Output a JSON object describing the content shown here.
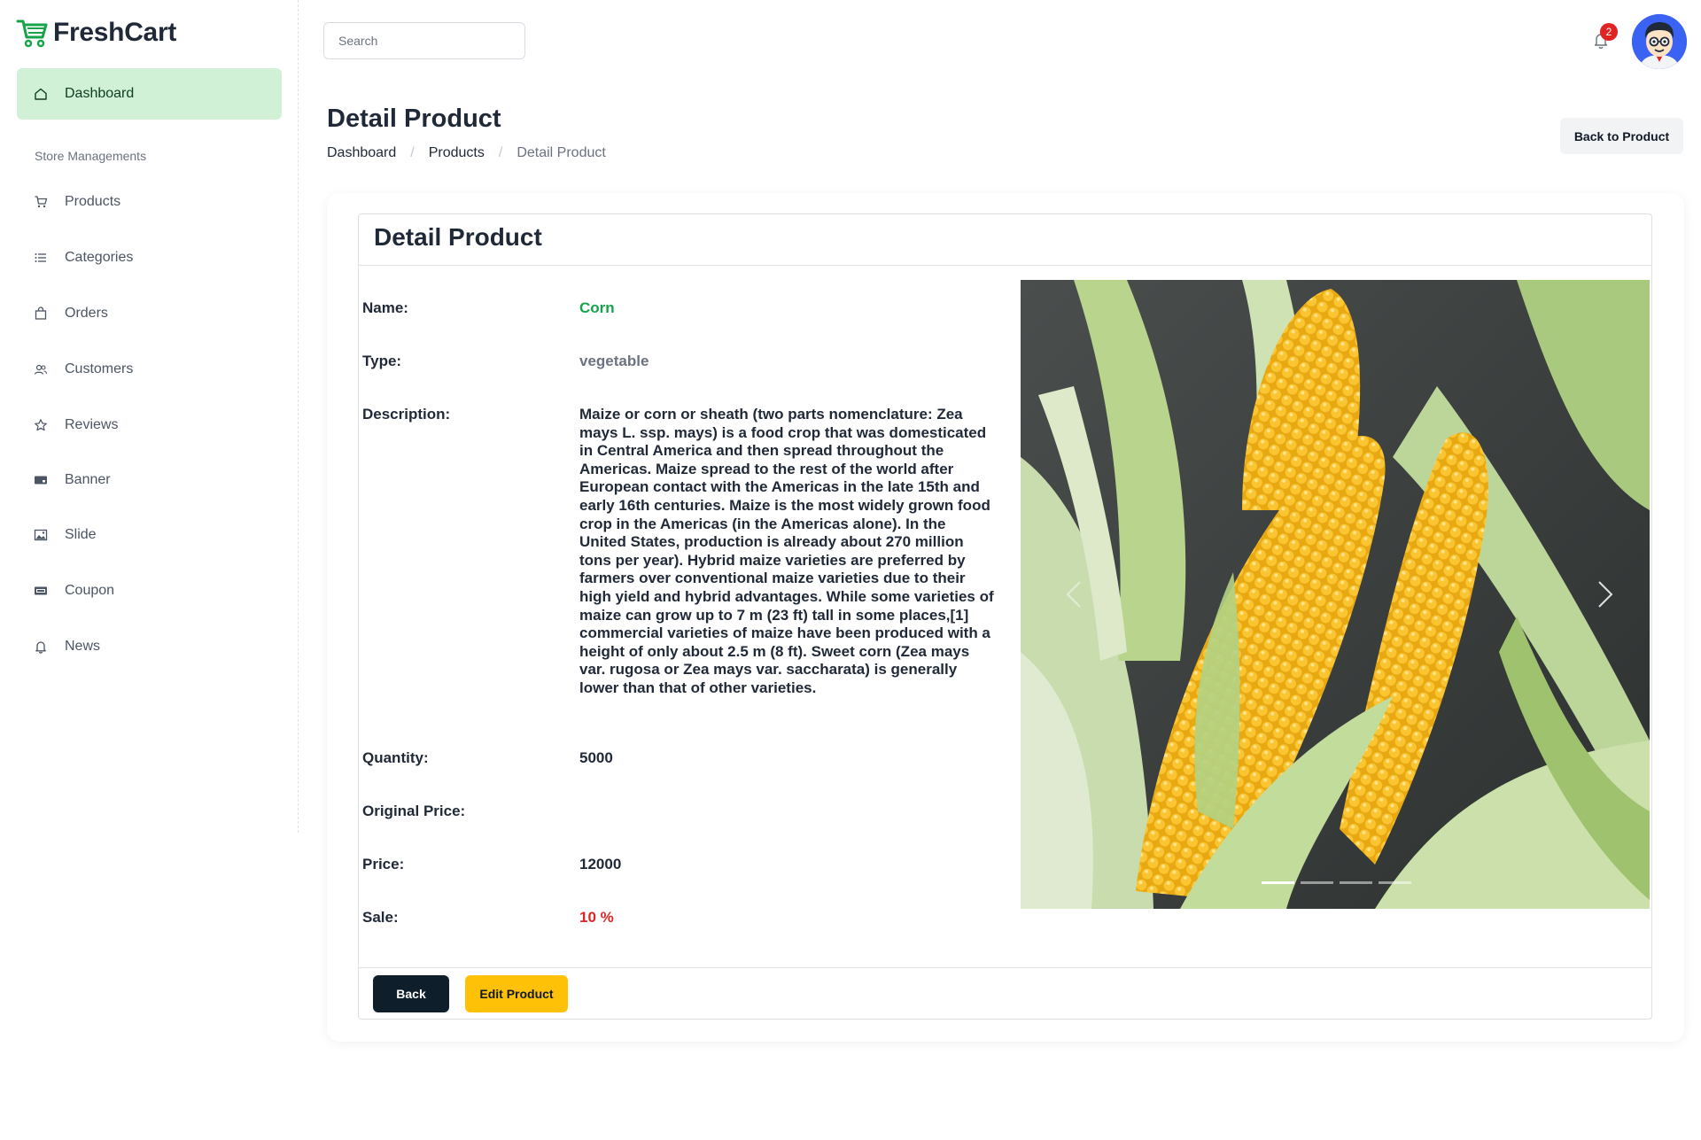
{
  "brand": {
    "name": "FreshCart"
  },
  "sidebar": {
    "active": {
      "label": "Dashboard",
      "icon": "home-icon"
    },
    "section": "Store Managements",
    "items": [
      {
        "label": "Products",
        "icon": "cart-icon"
      },
      {
        "label": "Categories",
        "icon": "list-icon"
      },
      {
        "label": "Orders",
        "icon": "bag-icon"
      },
      {
        "label": "Customers",
        "icon": "users-icon"
      },
      {
        "label": "Reviews",
        "icon": "star-icon"
      },
      {
        "label": "Banner",
        "icon": "banner-icon"
      },
      {
        "label": "Slide",
        "icon": "image-icon"
      },
      {
        "label": "Coupon",
        "icon": "ticket-icon"
      },
      {
        "label": "News",
        "icon": "bell-icon"
      }
    ]
  },
  "topbar": {
    "search_placeholder": "Search",
    "notifications": "2"
  },
  "page": {
    "title": "Detail Product",
    "breadcrumb": [
      "Dashboard",
      "Products",
      "Detail Product"
    ],
    "back_to_product": "Back to Product"
  },
  "card": {
    "title": "Detail Product",
    "labels": {
      "name": "Name:",
      "type": "Type:",
      "description": "Description:",
      "quantity": "Quantity:",
      "original_price": "Original Price:",
      "price": "Price:",
      "sale": "Sale:"
    },
    "product": {
      "name": "Corn",
      "type": "vegetable",
      "description": "Maize or corn or sheath (two parts nomenclature: Zea mays L. ssp. mays) is a food crop that was domesticated in Central America and then spread throughout the Americas. Maize spread to the rest of the world after European contact with the Americas in the late 15th and early 16th centuries. Maize is the most widely grown food crop in the Americas (in the Americas alone). In the United States, production is already about 270 million tons per year). Hybrid maize varieties are preferred by farmers over conventional maize varieties due to their high yield and hybrid advantages. While some varieties of maize can grow up to 7 m (23 ft) tall in some places,[1] commercial varieties of maize have been produced with a height of only about 2.5 m (8 ft). Sweet corn (Zea mays var. rugosa or Zea mays var. saccharata) is generally lower than that of other varieties.",
      "quantity": "5000",
      "original_price": "",
      "price": "12000",
      "sale": "10 %"
    },
    "carousel": {
      "slides": 4,
      "active_index": 0
    },
    "buttons": {
      "back": "Back",
      "edit": "Edit Product"
    }
  },
  "colors": {
    "accent": "#16a34a",
    "active_nav_bg": "#d1f1d6",
    "sale": "#dc2626",
    "edit_button": "#ffc107",
    "back_button": "#0e1f2b"
  }
}
